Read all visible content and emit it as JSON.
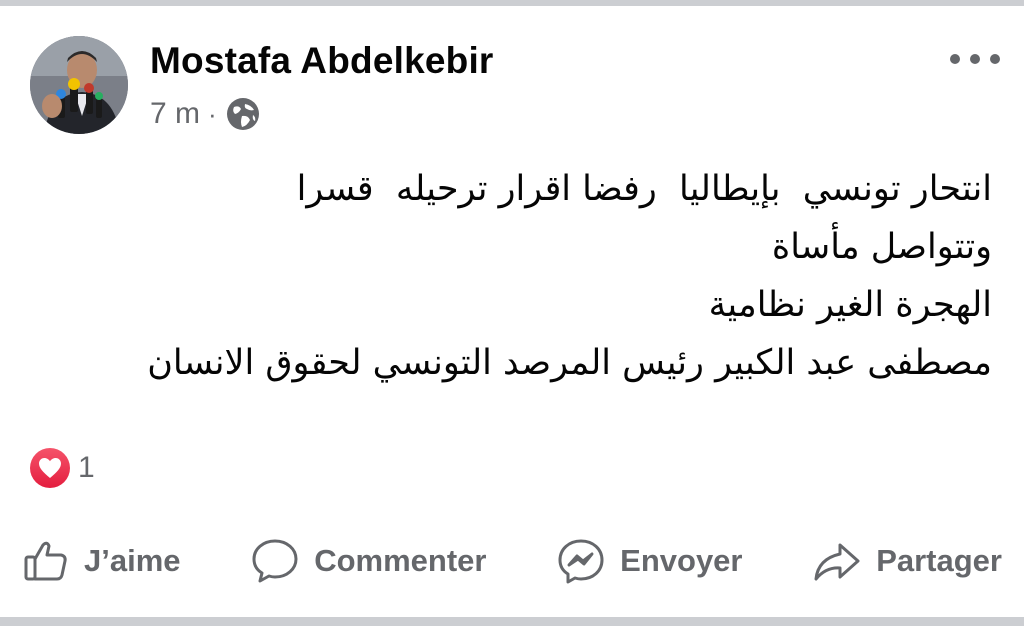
{
  "post": {
    "author": "Mostafa Abdelkebir",
    "timestamp": "7 m",
    "separator": "·",
    "audience_icon": "globe-icon",
    "more_icon": "more-options-icon",
    "lines": [
      "انتحار تونسي  بإيطاليا  رفضا اقرار ترحيله  قسرا",
      "وتتواصل مأساة",
      "الهجرة الغير نظامية",
      "مصطفى عبد الكبير رئيس المرصد التونسي لحقوق الانسان"
    ]
  },
  "reactions": {
    "icon": "heart-reaction-icon",
    "count": "1",
    "color": "#e41e3f"
  },
  "actions": {
    "like": {
      "label": "J’aime",
      "icon": "like-thumb-icon"
    },
    "comment": {
      "label": "Commenter",
      "icon": "comment-bubble-icon"
    },
    "send": {
      "label": "Envoyer",
      "icon": "messenger-icon"
    },
    "share": {
      "label": "Partager",
      "icon": "share-arrow-icon"
    }
  },
  "colors": {
    "text_primary": "#050505",
    "text_secondary": "#65676b",
    "divider": "#ccced2"
  }
}
